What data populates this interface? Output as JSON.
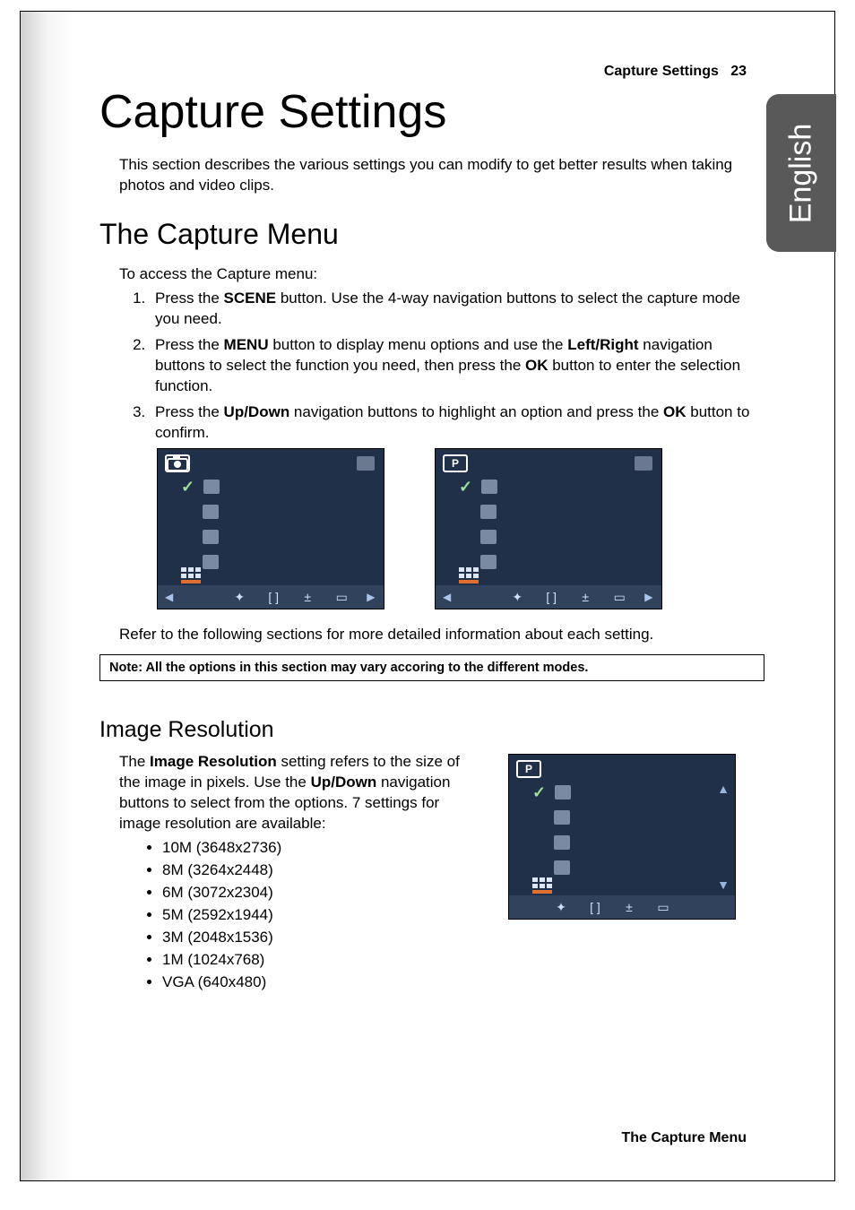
{
  "header": {
    "section": "Capture Settings",
    "page_num": "23"
  },
  "tab_label": "English",
  "title": "Capture Settings",
  "intro": "This section describes the various settings you can modify to get better results when taking photos and video clips.",
  "h2": "The Capture Menu",
  "access_line": "To access the Capture menu:",
  "steps": {
    "s1a": "Press the ",
    "s1b": "SCENE",
    "s1c": " button. Use the 4-way navigation buttons to select the capture mode you need.",
    "s2a": "Press the ",
    "s2b": "MENU",
    "s2c": " button to display menu options and use the ",
    "s2d": "Left/Right",
    "s2e": " navigation buttons to select the function you need, then press the ",
    "s2f": "OK",
    "s2g": " button to enter the selection function.",
    "s3a": "Press the ",
    "s3b": "Up/Down",
    "s3c": " navigation buttons to highlight an option and press the ",
    "s3d": "OK",
    "s3e": " button to confirm."
  },
  "screen_left_mode": "camera",
  "screen_right_mode": "P",
  "refer_line": "Refer to the following sections for more detailed information about each setting.",
  "note_text": "Note: All the options in this section may vary accoring to the different modes.",
  "h3": "Image Resolution",
  "res_para": {
    "a": "The ",
    "b": "Image Resolution",
    "c": " setting refers to the size of the image in pixels. Use the ",
    "d": "Up/Down",
    "e": " navigation buttons to select from the options. 7 settings for image resolution are available:"
  },
  "resolutions": [
    "10M (3648x2736)",
    "8M (3264x2448)",
    "6M (3072x2304)",
    "5M (2592x1944)",
    "3M (2048x1536)",
    "1M (1024x768)",
    "VGA (640x480)"
  ],
  "footer_label": "The Capture Menu"
}
